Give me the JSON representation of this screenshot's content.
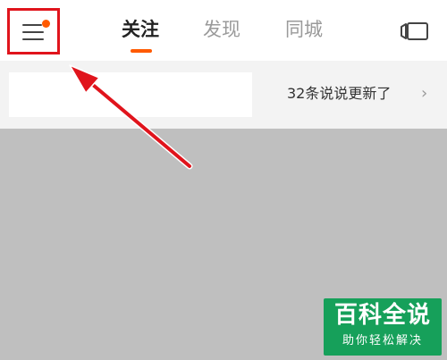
{
  "header": {
    "tabs": [
      {
        "label": "关注",
        "active": true
      },
      {
        "label": "发现",
        "active": false
      },
      {
        "label": "同城",
        "active": false
      }
    ],
    "menu_icon": "hamburger-menu-icon",
    "menu_badge_color": "#ff5a00",
    "right_icon": "screen-cast-icon"
  },
  "notice": {
    "text": "32条说说更新了",
    "chevron": "›"
  },
  "annotation": {
    "highlight_color": "#e0141c",
    "arrow_color": "#e0141c"
  },
  "watermark": {
    "title": "百科全说",
    "subtitle": "助你轻松解决",
    "color": "#16a05a"
  }
}
